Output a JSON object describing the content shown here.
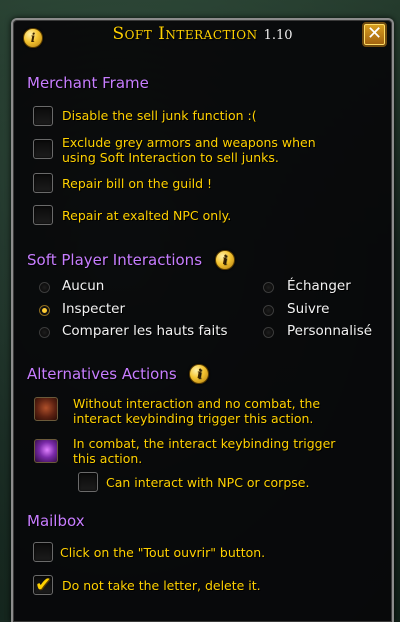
{
  "window": {
    "title": "Soft Interaction",
    "version": "1.10",
    "info_icon": "i",
    "close_icon": "✕"
  },
  "merchant": {
    "title": "Merchant Frame",
    "options": [
      {
        "label": "Disable the sell junk function :(",
        "checked": false
      },
      {
        "label": "Exclude grey armors and weapons when using Soft Interaction to sell junks.",
        "checked": false
      },
      {
        "label": "Repair bill on the guild !",
        "checked": false
      },
      {
        "label": "Repair at exalted NPC only.",
        "checked": false
      }
    ]
  },
  "soft_player": {
    "title": "Soft Player Interactions",
    "info_icon": "i",
    "options": [
      {
        "label": "Aucun",
        "selected": false
      },
      {
        "label": "Échanger",
        "selected": false
      },
      {
        "label": "Inspecter",
        "selected": true
      },
      {
        "label": "Suivre",
        "selected": false
      },
      {
        "label": "Comparer les hauts faits",
        "selected": false
      },
      {
        "label": "Personnalisé",
        "selected": false
      }
    ]
  },
  "alternatives": {
    "title": "Alternatives Actions",
    "info_icon": "i",
    "no_combat_text": "Without interaction and no combat, the interact keybinding trigger this action.",
    "combat_text": "In combat, the interact keybinding trigger this action.",
    "npc_option": {
      "label": "Can interact with NPC or corpse.",
      "checked": false
    }
  },
  "mailbox": {
    "title": "Mailbox",
    "options": [
      {
        "label": "Click on the \"Tout ouvrir\" button.",
        "checked": false
      },
      {
        "label": "Do not take the letter, delete it.",
        "checked": true
      }
    ],
    "check_glyph": "✔"
  },
  "colors": {
    "section_title": "#c77dff",
    "label": "#ffd100",
    "title": "#ffd100",
    "panel_bg": "#080808"
  }
}
